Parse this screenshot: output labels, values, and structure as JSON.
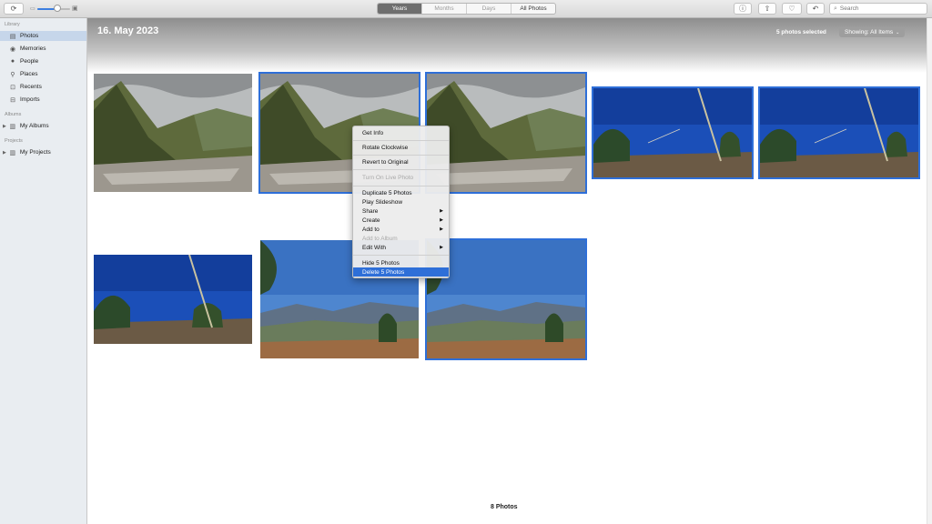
{
  "toolbar": {
    "view_tabs": [
      {
        "label": "Years",
        "active": true
      },
      {
        "label": "Months",
        "active": false
      },
      {
        "label": "Days",
        "active": false
      },
      {
        "label": "All Photos",
        "active": false
      }
    ],
    "search_placeholder": "Search",
    "icons": [
      "rotate-icon",
      "zoom-small-icon",
      "zoom-large-icon",
      "info-icon",
      "share-icon",
      "heart-icon",
      "rotate-left-icon",
      "search-icon"
    ]
  },
  "sidebar": {
    "library_header": "Library",
    "library_items": [
      {
        "label": "Photos",
        "icon": "photos-icon",
        "selected": true
      },
      {
        "label": "Memories",
        "icon": "memories-icon",
        "selected": false
      },
      {
        "label": "People",
        "icon": "people-icon",
        "selected": false
      },
      {
        "label": "Places",
        "icon": "places-icon",
        "selected": false
      },
      {
        "label": "Recents",
        "icon": "recents-icon",
        "selected": false
      },
      {
        "label": "Imports",
        "icon": "imports-icon",
        "selected": false
      }
    ],
    "albums_header": "Albums",
    "albums_item": "My Albums",
    "projects_header": "Projects",
    "projects_item": "My Projects"
  },
  "main": {
    "date_title": "16. May 2023",
    "selected_count": "5 photos selected",
    "showing_label": "Showing: All Items",
    "footer_count": "8 Photos"
  },
  "photos": [
    {
      "scene": "mountain-valley",
      "selected": false
    },
    {
      "scene": "mountain-valley",
      "selected": true
    },
    {
      "scene": "mountain-valley",
      "selected": true
    },
    {
      "scene": "blue-sky-tree",
      "selected": true
    },
    {
      "scene": "blue-sky-tree",
      "selected": true
    },
    {
      "scene": "blue-sky-tree",
      "selected": false
    },
    {
      "scene": "hills-trees",
      "selected": false
    },
    {
      "scene": "hills-trees",
      "selected": true
    }
  ],
  "context_menu": {
    "items": [
      {
        "label": "Get Info",
        "disabled": false
      },
      {
        "label": "Rotate Clockwise",
        "disabled": false
      },
      {
        "label": "Revert to Original",
        "disabled": false
      },
      {
        "label": "Turn On Live Photo",
        "disabled": true
      },
      {
        "label": "Duplicate 5 Photos",
        "disabled": false
      },
      {
        "label": "Play Slideshow",
        "disabled": false
      },
      {
        "label": "Share",
        "disabled": false,
        "submenu": true
      },
      {
        "label": "Create",
        "disabled": false,
        "submenu": true
      },
      {
        "label": "Add to",
        "disabled": false,
        "submenu": true
      },
      {
        "label": "Add to Album",
        "disabled": true
      },
      {
        "label": "Edit With",
        "disabled": false,
        "submenu": true
      },
      {
        "label": "Hide 5 Photos",
        "disabled": false
      },
      {
        "label": "Delete 5 Photos",
        "disabled": false,
        "highlighted": true
      }
    ]
  },
  "colors": {
    "accent": "#2e6fd8",
    "sidebar_bg": "#e9edf1",
    "sidebar_selected": "#c6d6ea"
  }
}
